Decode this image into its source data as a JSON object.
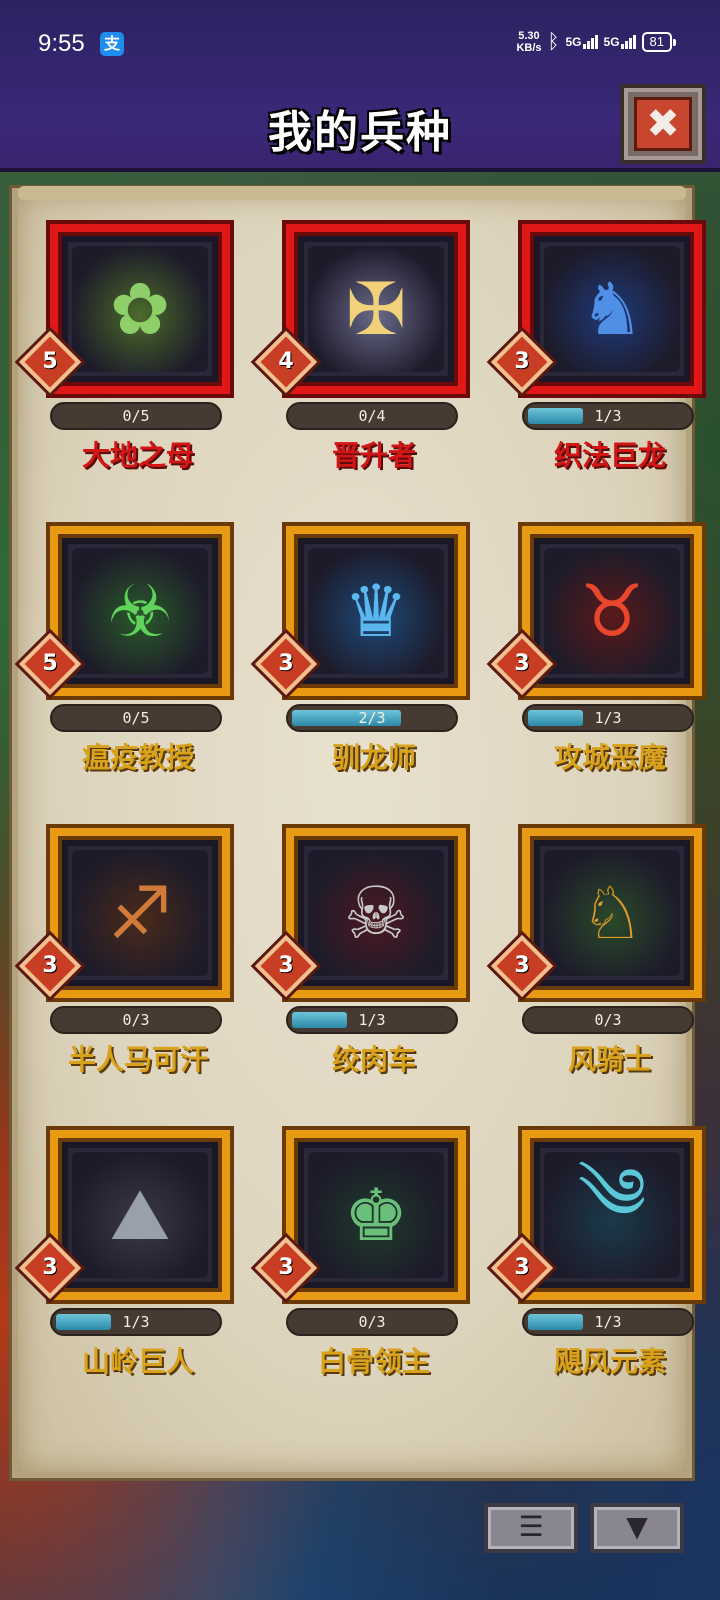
{
  "status_bar": {
    "time": "9:55",
    "app_icon": "支",
    "net_speed_value": "5.30",
    "net_speed_unit": "KB/s",
    "signal_1": "5G",
    "signal_2": "5G",
    "battery": "81"
  },
  "header": {
    "title": "我的兵种",
    "close_icon": "close-icon",
    "close_symbol": "✖"
  },
  "units": [
    {
      "cost": "5",
      "progress": "0/5",
      "fill": 0.0,
      "name": "大地之母",
      "rarity": "red",
      "glyph": "✿",
      "glow": "#4b6b2a",
      "glyph_color": "#8fcf6a"
    },
    {
      "cost": "4",
      "progress": "0/4",
      "fill": 0.0,
      "name": "晋升者",
      "rarity": "red",
      "glyph": "✠",
      "glow": "#6a6a8a",
      "glyph_color": "#f1d27a"
    },
    {
      "cost": "3",
      "progress": "1/3",
      "fill": 0.333,
      "name": "织法巨龙",
      "rarity": "red",
      "glyph": "♞",
      "glow": "#1e3a7a",
      "glyph_color": "#4f8fe6"
    },
    {
      "cost": "5",
      "progress": "0/5",
      "fill": 0.0,
      "name": "瘟疫教授",
      "rarity": "gold",
      "glyph": "☣",
      "glow": "#2a5a2a",
      "glyph_color": "#5fd35a"
    },
    {
      "cost": "3",
      "progress": "2/3",
      "fill": 0.667,
      "name": "驯龙师",
      "rarity": "gold",
      "glyph": "♛",
      "glow": "#1e4a7a",
      "glyph_color": "#5ab8ee"
    },
    {
      "cost": "3",
      "progress": "1/3",
      "fill": 0.333,
      "name": "攻城恶魔",
      "rarity": "gold",
      "glyph": "♉",
      "glow": "#5a1a1a",
      "glyph_color": "#e8472c"
    },
    {
      "cost": "3",
      "progress": "0/3",
      "fill": 0.0,
      "name": "半人马可汗",
      "rarity": "gold",
      "glyph": "♐",
      "glow": "#4a2a1a",
      "glyph_color": "#d07a3a"
    },
    {
      "cost": "3",
      "progress": "1/3",
      "fill": 0.333,
      "name": "绞肉车",
      "rarity": "gold",
      "glyph": "☠",
      "glow": "#4a1a22",
      "glyph_color": "#c9c9c9"
    },
    {
      "cost": "3",
      "progress": "0/3",
      "fill": 0.0,
      "name": "风骑士",
      "rarity": "gold",
      "glyph": "♘",
      "glow": "#2a4a2a",
      "glyph_color": "#e09a2a"
    },
    {
      "cost": "3",
      "progress": "1/3",
      "fill": 0.333,
      "name": "山岭巨人",
      "rarity": "gold",
      "glyph": "⛰",
      "glow": "#3a3a44",
      "glyph_color": "#9aa0aa"
    },
    {
      "cost": "3",
      "progress": "0/3",
      "fill": 0.0,
      "name": "白骨领主",
      "rarity": "gold",
      "glyph": "♚",
      "glow": "#1e3a2a",
      "glyph_color": "#6abf7a"
    },
    {
      "cost": "3",
      "progress": "1/3",
      "fill": 0.333,
      "name": "飓风元素",
      "rarity": "gold",
      "glyph": "༄",
      "glow": "#1a3a4a",
      "glyph_color": "#5ac8d8"
    }
  ],
  "bottom_bar": {
    "list_icon": "list-icon",
    "list_symbol": "☰",
    "filter_icon": "filter-icon",
    "filter_symbol": "▼"
  },
  "colors": {
    "header_bg": "#3a2878",
    "frame_red": "#e01818",
    "frame_gold": "#e89a12",
    "cost_badge": "#c83e24",
    "progress_fill": "#2b8aa8"
  }
}
